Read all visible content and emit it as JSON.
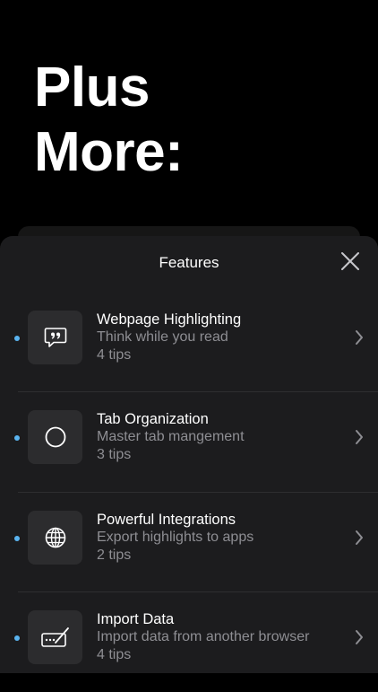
{
  "hero": {
    "line1": "Plus",
    "line2": "More:"
  },
  "sheet": {
    "title": "Features"
  },
  "features": [
    {
      "title": "Webpage Highlighting",
      "subtitle": "Think while you read",
      "tips": "4 tips",
      "icon": "quote-bubble-icon"
    },
    {
      "title": "Tab Organization",
      "subtitle": "Master tab mangement",
      "tips": "3 tips",
      "icon": "circle-icon"
    },
    {
      "title": "Powerful Integrations",
      "subtitle": "Export highlights to apps",
      "tips": "2 tips",
      "icon": "globe-icon"
    },
    {
      "title": "Import Data",
      "subtitle": "Import data from another browser",
      "tips": "4 tips",
      "icon": "import-pen-icon"
    }
  ],
  "colors": {
    "accent_dot": "#5ab4f0",
    "sheet_bg": "#1c1c1e",
    "tile_bg": "#2c2c2e",
    "secondary_text": "#8e8e93"
  }
}
